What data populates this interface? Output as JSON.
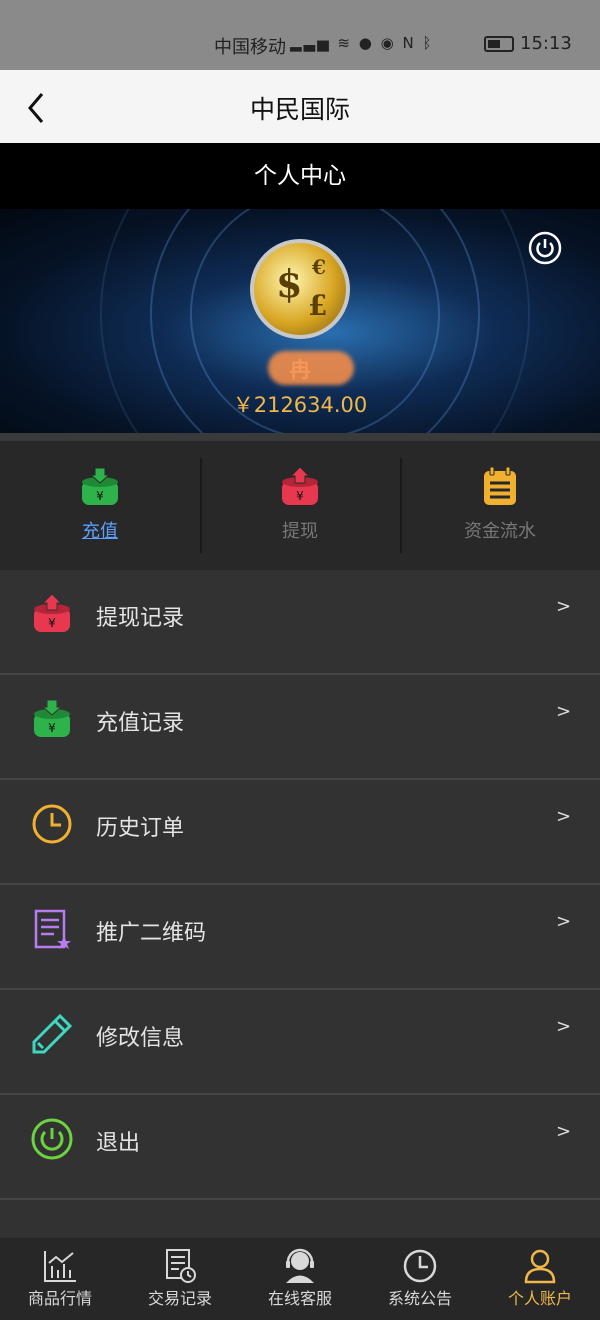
{
  "status_bar": {
    "carrier": "中国移动",
    "time": "15:13"
  },
  "nav": {
    "title": "中民国际"
  },
  "header": {
    "title": "个人中心"
  },
  "profile": {
    "username": "冉",
    "balance": "￥212634.00"
  },
  "actions": [
    {
      "label": "充值",
      "icon": "deposit-icon",
      "color": "#2db34a",
      "active": true
    },
    {
      "label": "提现",
      "icon": "withdraw-icon",
      "color": "#e8384f",
      "active": false
    },
    {
      "label": "资金流水",
      "icon": "clipboard-icon",
      "color": "#f0b030",
      "active": false
    }
  ],
  "menu": [
    {
      "label": "提现记录",
      "icon": "withdraw-icon",
      "color": "#e8384f",
      "arrow": ">"
    },
    {
      "label": "充值记录",
      "icon": "deposit-icon",
      "color": "#2db34a",
      "arrow": ">"
    },
    {
      "label": "历史订单",
      "icon": "clock-icon",
      "color": "#f0b030",
      "arrow": ">"
    },
    {
      "label": "推广二维码",
      "icon": "document-star-icon",
      "color": "#b67cf0",
      "arrow": ">"
    },
    {
      "label": "修改信息",
      "icon": "pencil-icon",
      "color": "#3fd6c0",
      "arrow": ">"
    },
    {
      "label": "退出",
      "icon": "power-icon",
      "color": "#6bd33f",
      "arrow": ">"
    }
  ],
  "tabs": [
    {
      "label": "商品行情",
      "icon": "chart-icon",
      "active": false
    },
    {
      "label": "交易记录",
      "icon": "records-icon",
      "active": false
    },
    {
      "label": "在线客服",
      "icon": "support-icon",
      "active": false
    },
    {
      "label": "系统公告",
      "icon": "clock-icon",
      "active": false
    },
    {
      "label": "个人账户",
      "icon": "user-icon",
      "active": true
    }
  ],
  "colors": {
    "accent_gold": "#f0b84a",
    "active_link": "#5aa0ff"
  }
}
